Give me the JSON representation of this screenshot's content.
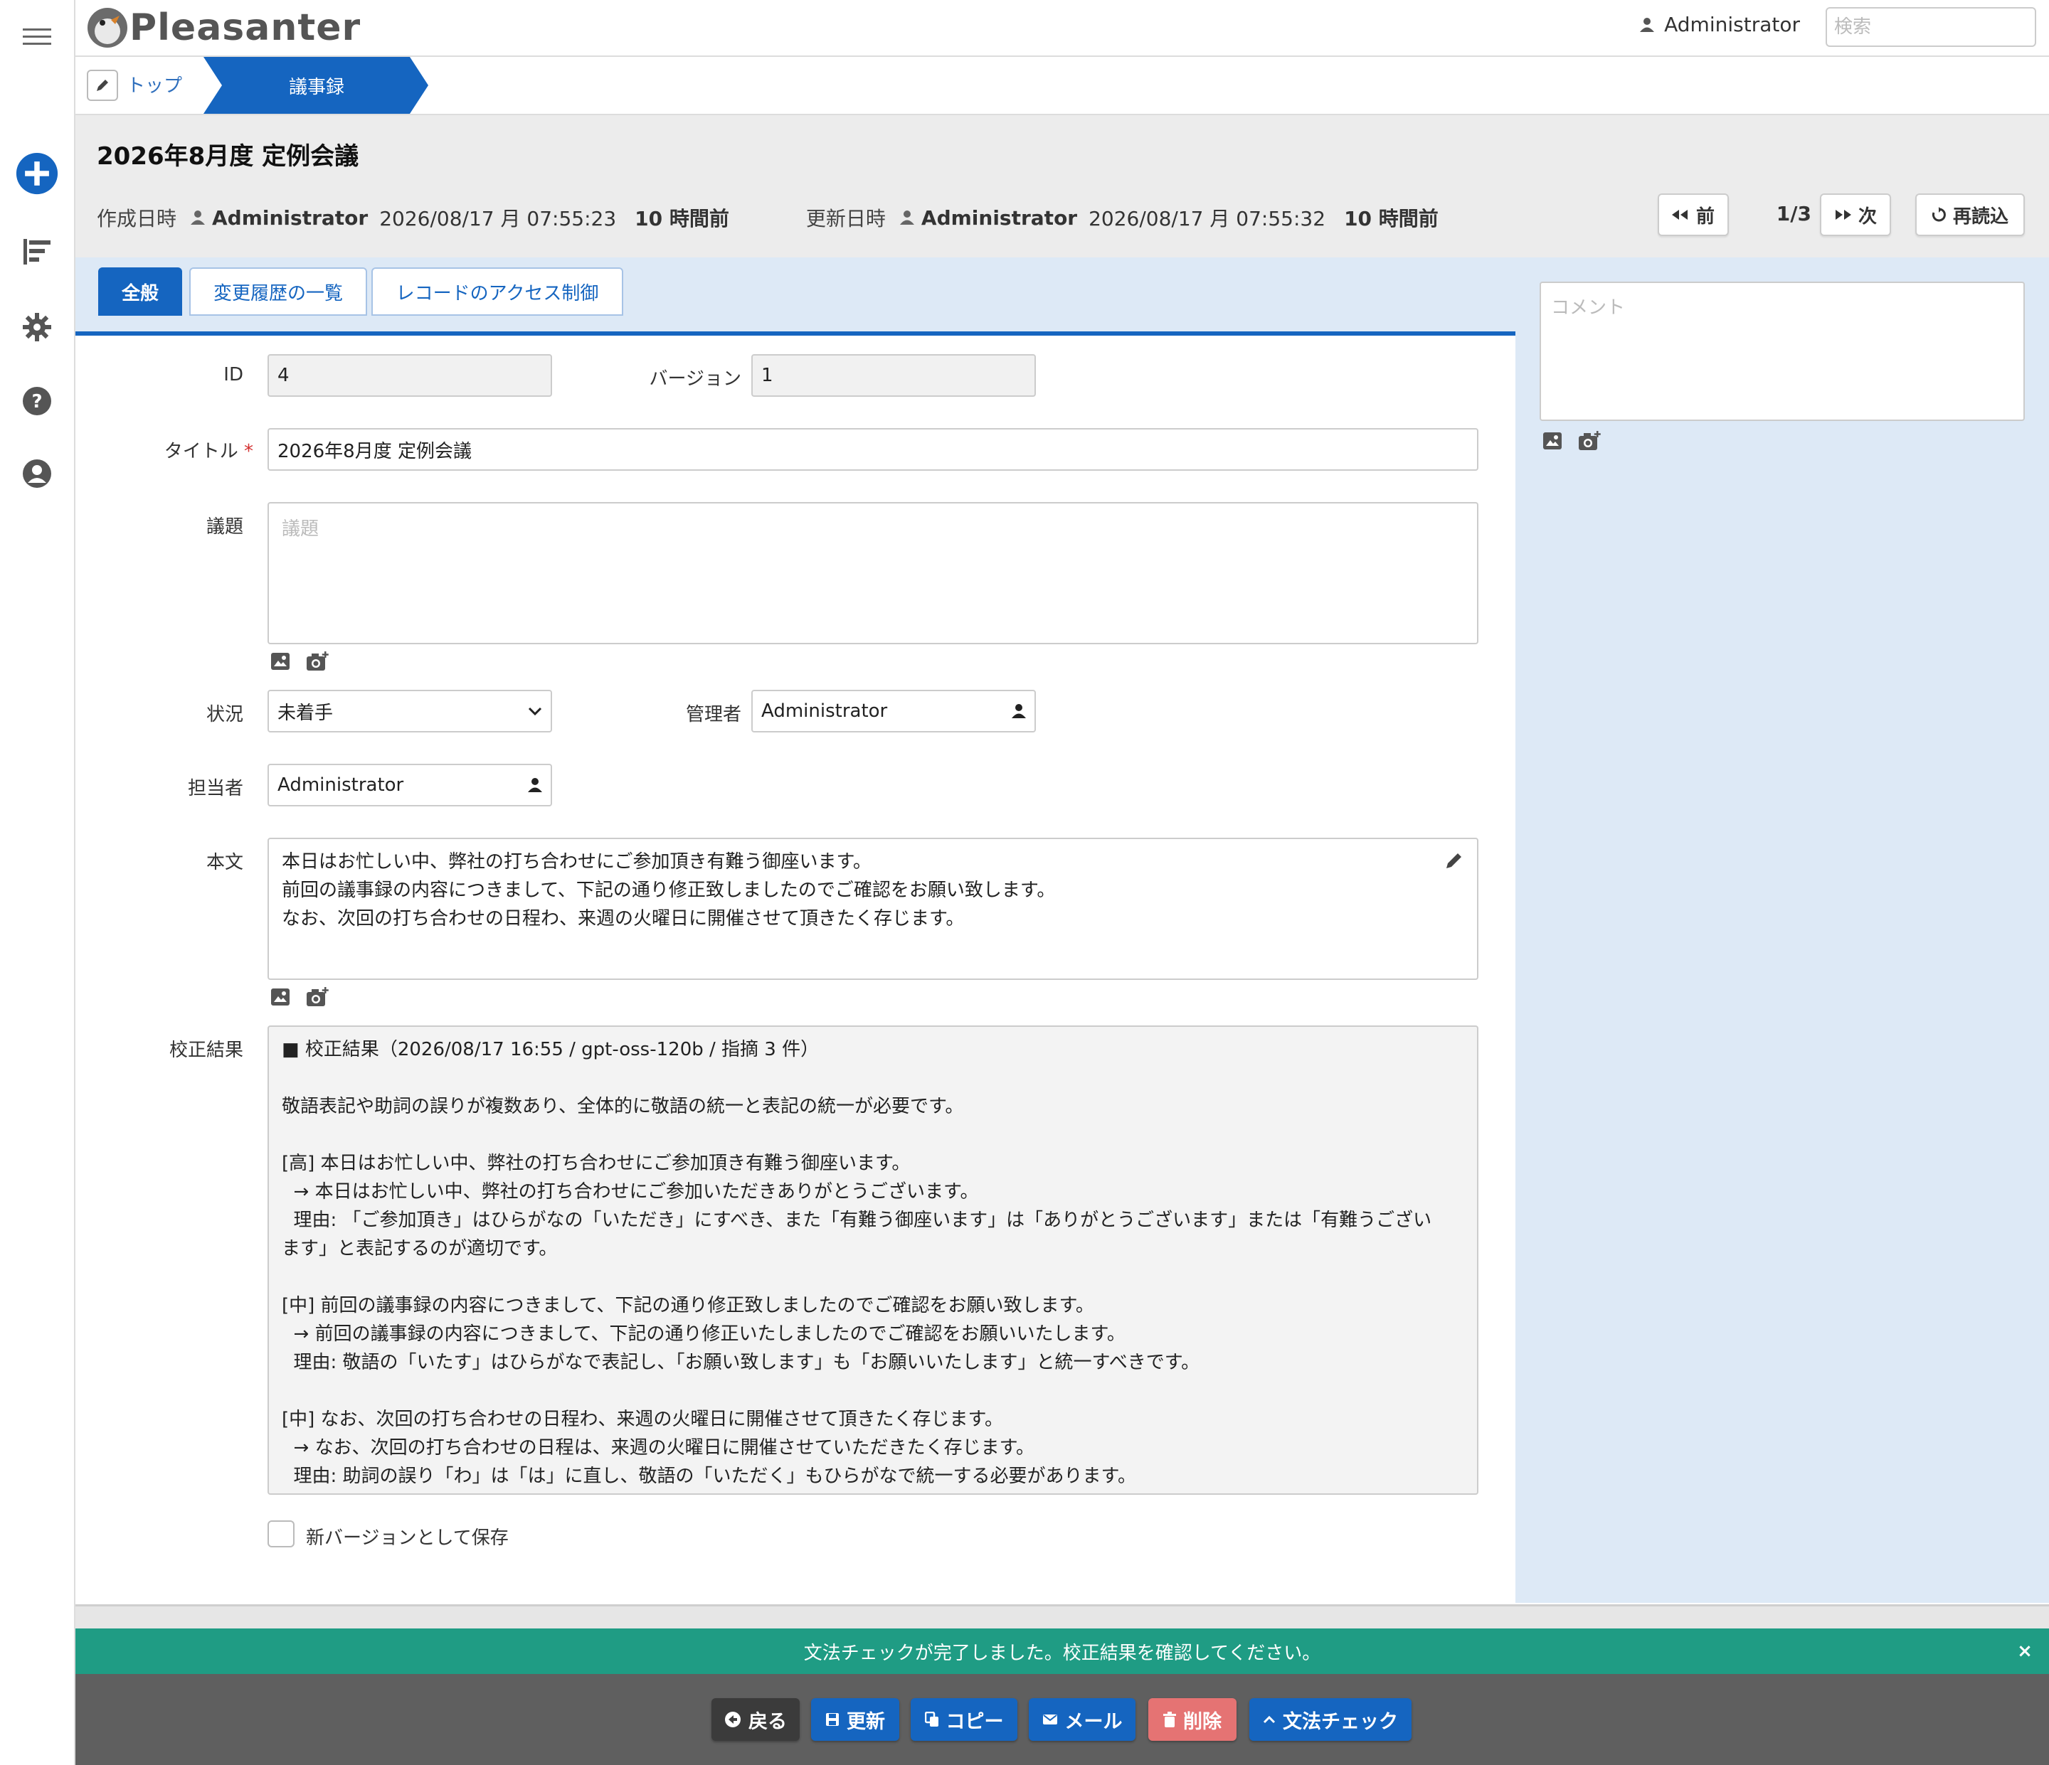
{
  "app": {
    "logo_text": "Pleasanter",
    "user_name": "Administrator",
    "search_placeholder": "検索"
  },
  "breadcrumb": {
    "top_label": "トップ",
    "current_label": "議事録"
  },
  "record": {
    "title": "2026年8月度 定例会議",
    "created_label": "作成日時",
    "created_by": "Administrator",
    "created_at": "2026/08/17 月 07:55:23",
    "created_ago": "10 時間前",
    "updated_label": "更新日時",
    "updated_by": "Administrator",
    "updated_at": "2026/08/17 月 07:55:32",
    "updated_ago": "10 時間前",
    "prev_label": "前",
    "next_label": "次",
    "page_counter": "1/3",
    "reload_label": "再読込"
  },
  "tabs": [
    {
      "label": "全般",
      "active": true
    },
    {
      "label": "変更履歴の一覧",
      "active": false
    },
    {
      "label": "レコードのアクセス制御",
      "active": false
    }
  ],
  "form": {
    "id_label": "ID",
    "id_value": "4",
    "version_label": "バージョン",
    "version_value": "1",
    "title_label": "タイトル",
    "required_mark": "*",
    "title_value": "2026年8月度 定例会議",
    "agenda_label": "議題",
    "agenda_placeholder": "議題",
    "status_label": "状況",
    "status_value": "未着手",
    "manager_label": "管理者",
    "manager_value": "Administrator",
    "owner_label": "担当者",
    "owner_value": "Administrator",
    "body_label": "本文",
    "body_lines": [
      "本日はお忙しい中、弊社の打ち合わせにご参加頂き有難う御座います。",
      "前回の議事録の内容につきまして、下記の通り修正致しましたのでご確認をお願い致します。",
      "なお、次回の打ち合わせの日程わ、来週の火曜日に開催させて頂きたく存じます。"
    ],
    "proof_label": "校正結果",
    "proof_lines": [
      "■ 校正結果（2026/08/17 16:55 / gpt-oss-120b / 指摘 3 件）",
      "",
      "敬語表記や助詞の誤りが複数あり、全体的に敬語の統一と表記の統一が必要です。",
      "",
      "[高] 本日はお忙しい中、弊社の打ち合わせにご参加頂き有難う御座います。",
      "  → 本日はお忙しい中、弊社の打ち合わせにご参加いただきありがとうございます。",
      "  理由: 「ご参加頂き」はひらがなの「いただき」にすべき、また「有難う御座います」は「ありがとうございます」または「有難うござい",
      "ます」と表記するのが適切です。",
      "",
      "[中] 前回の議事録の内容につきまして、下記の通り修正致しましたのでご確認をお願い致します。",
      "  → 前回の議事録の内容につきまして、下記の通り修正いたしましたのでご確認をお願いいたします。",
      "  理由: 敬語の「いたす」はひらがなで表記し、「お願い致します」も「お願いいたします」と統一すべきです。",
      "",
      "[中] なお、次回の打ち合わせの日程わ、来週の火曜日に開催させて頂きたく存じます。",
      "  → なお、次回の打ち合わせの日程は、来週の火曜日に開催させていただきたく存じます。",
      "  理由: 助詞の誤り「わ」は「は」に直し、敬語の「いただく」もひらがなで統一する必要があります。"
    ],
    "new_version_label": "新バージョンとして保存"
  },
  "comment": {
    "placeholder": "コメント"
  },
  "notification": {
    "message": "文法チェックが完了しました。校正結果を確認してください。",
    "close": "×"
  },
  "actions": {
    "back": "戻る",
    "update": "更新",
    "copy": "コピー",
    "mail": "メール",
    "delete": "削除",
    "grammar": "文法チェック"
  },
  "colors": {
    "primary": "#1565c0",
    "accent_panel": "#dde9f6",
    "success": "#1f9c84",
    "danger": "#e57373",
    "dark_button": "#3b3b3b"
  }
}
